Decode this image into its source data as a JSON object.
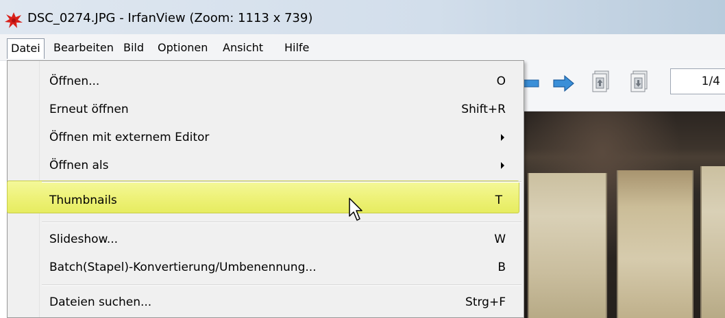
{
  "window": {
    "title": "DSC_0274.JPG - IrfanView (Zoom: 1113 x 739)"
  },
  "menubar": {
    "items": [
      {
        "label": "Datei"
      },
      {
        "label": "Bearbeiten"
      },
      {
        "label": "Bild"
      },
      {
        "label": "Optionen"
      },
      {
        "label": "Ansicht"
      },
      {
        "label": "Hilfe"
      }
    ]
  },
  "toolbar": {
    "page_indicator": "1/4",
    "icons": [
      "arrow-left-icon",
      "arrow-right-icon",
      "first-page-icon",
      "last-page-icon"
    ]
  },
  "dropdown": {
    "items": [
      {
        "label": "Öffnen...",
        "shortcut": "O"
      },
      {
        "label": "Erneut öffnen",
        "shortcut": "Shift+R"
      },
      {
        "label": "Öffnen mit externem Editor",
        "submenu": true
      },
      {
        "label": "Öffnen als",
        "submenu": true
      },
      {
        "label": "Thumbnails",
        "shortcut": "T"
      },
      {
        "label": "Slideshow...",
        "shortcut": "W"
      },
      {
        "label": "Batch(Stapel)-Konvertierung/Umbenennung...",
        "shortcut": "B"
      },
      {
        "label": "Dateien suchen...",
        "shortcut": "Strg+F"
      }
    ],
    "highlighted": "Thumbnails"
  },
  "colors": {
    "highlight": "#eef27a",
    "highlight_border": "#c6cb4a",
    "toolbar_arrow": "#3a8fd8"
  }
}
